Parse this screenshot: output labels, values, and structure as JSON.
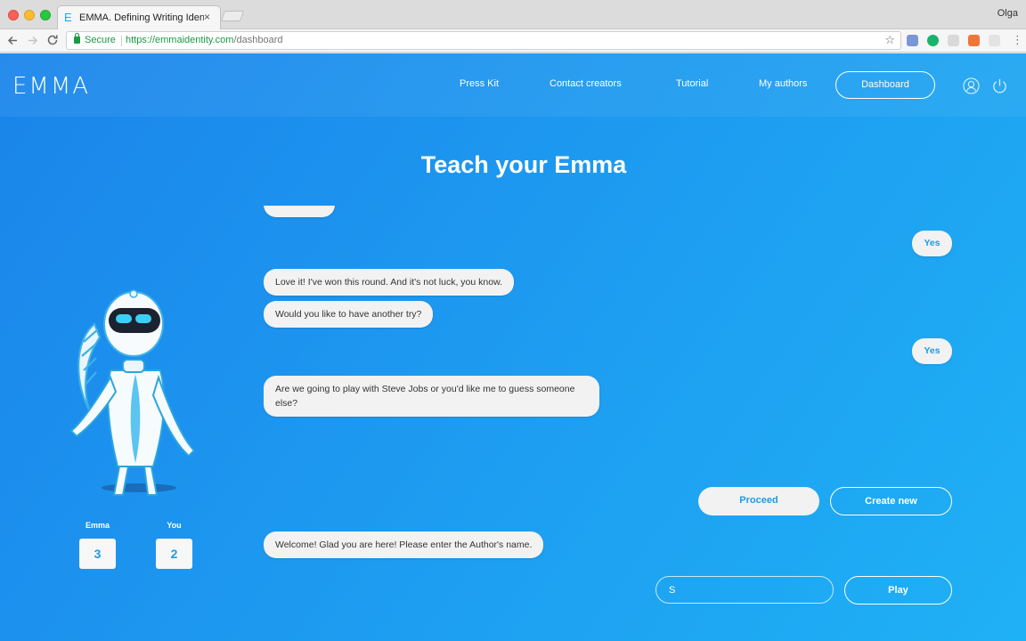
{
  "browser": {
    "tab_title": "EMMA. Defining Writing Identity",
    "tab_favicon": "E",
    "tab_close": "×",
    "profile_name": "Olga",
    "secure_label": "Secure",
    "url_host": "https://emmaidentity.com",
    "url_path": "/dashboard",
    "icons": {
      "back": "back-arrow-icon",
      "forward": "forward-arrow-icon",
      "reload": "reload-icon",
      "bookmark": "star-icon"
    }
  },
  "nav": {
    "logo": "EMMA",
    "links": [
      "Press Kit",
      "Contact creators",
      "Tutorial",
      "My authors"
    ],
    "dashboard_label": "Dashboard",
    "icons": [
      "user-icon",
      "power-icon"
    ]
  },
  "main": {
    "title": "Teach your Emma"
  },
  "chat": {
    "messages": [
      {
        "from": "user",
        "text": "Yes"
      },
      {
        "from": "emma",
        "text": "Love it! I've won this round. And it's not luck, you know."
      },
      {
        "from": "emma",
        "text": "Would you like to have another try?"
      },
      {
        "from": "user",
        "text": "Yes"
      },
      {
        "from": "emma",
        "text": "Are we going to play with Steve Jobs or you'd like me to guess someone else?"
      },
      {
        "from": "emma",
        "text": "Welcome! Glad you are here! Please enter the Author's name."
      }
    ],
    "proceed_label": "Proceed",
    "create_new_label": "Create new",
    "author_input_value": "S",
    "play_label": "Play"
  },
  "score": {
    "emma_label": "Emma",
    "emma_value": "3",
    "you_label": "You",
    "you_value": "2"
  },
  "colors": {
    "background_start": "#1a84ea",
    "background_end": "#1fb1f5",
    "accent": "#1e9be6",
    "bubble": "#f2f2f2"
  }
}
